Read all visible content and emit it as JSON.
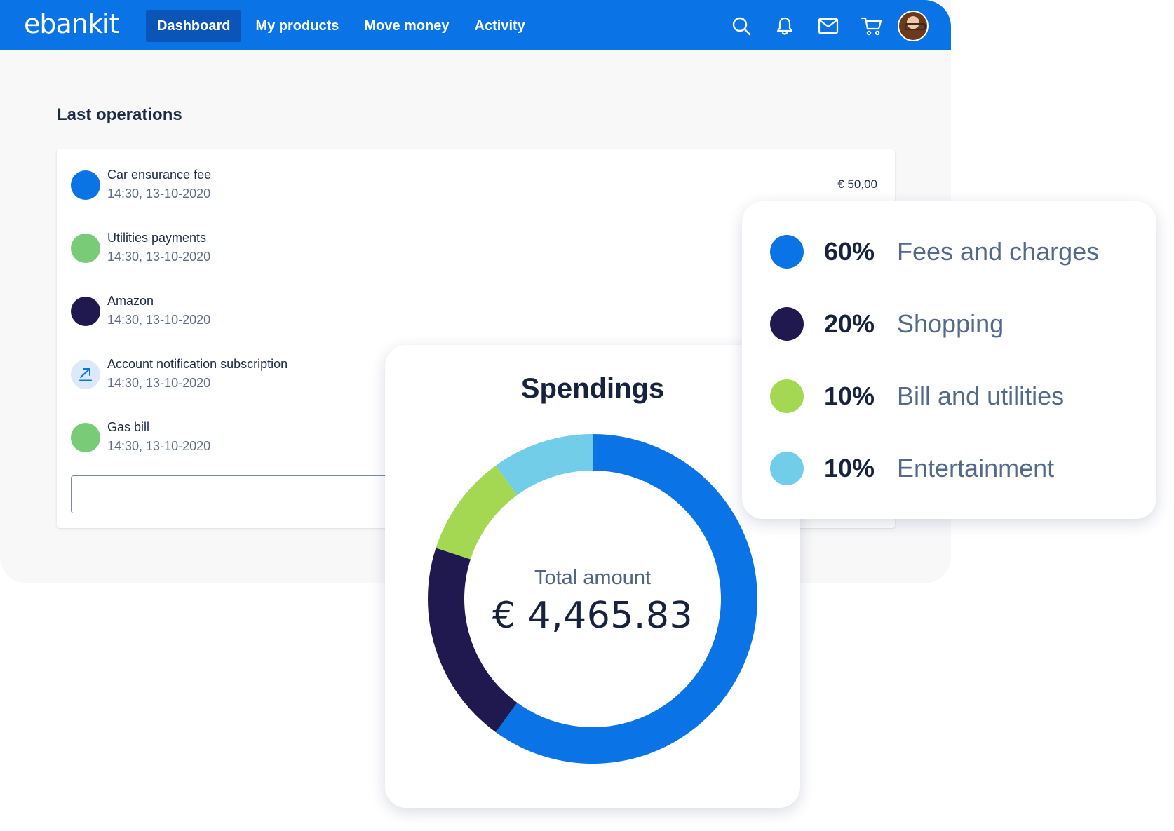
{
  "brand": {
    "logo_text": "ebankit",
    "primary_color": "#0a74e6"
  },
  "nav": {
    "tabs": [
      {
        "label": "Dashboard",
        "active": true
      },
      {
        "label": "My products",
        "active": false
      },
      {
        "label": "Move money",
        "active": false
      },
      {
        "label": "Activity",
        "active": false
      }
    ],
    "icons": [
      "search-icon",
      "bell-icon",
      "mail-icon",
      "cart-icon",
      "avatar"
    ]
  },
  "operations": {
    "title": "Last operations",
    "items": [
      {
        "title": "Car ensurance fee",
        "time": "14:30, 13-10-2020",
        "amount": "€ 50,00",
        "color": "#0a74e6",
        "icon": "dot"
      },
      {
        "title": "Utilities payments",
        "time": "14:30, 13-10-2020",
        "amount": "",
        "color": "#7acb78",
        "icon": "dot"
      },
      {
        "title": "Amazon",
        "time": "14:30, 13-10-2020",
        "amount": "",
        "color": "#20194f",
        "icon": "dot"
      },
      {
        "title": "Account notification subscription",
        "time": "14:30, 13-10-2020",
        "amount": "",
        "color": "#dbe9fb",
        "icon": "arrow-up-right-icon"
      },
      {
        "title": "Gas bill",
        "time": "14:30, 13-10-2020",
        "amount": "",
        "color": "#7acb78",
        "icon": "dot"
      }
    ]
  },
  "spendings": {
    "title": "Spendings",
    "total_label": "Total amount",
    "total_value": "€ 4,465.83"
  },
  "chart_data": {
    "type": "pie",
    "title": "Spendings",
    "categories": [
      "Fees and charges",
      "Shopping",
      "Bill and utilities",
      "Entertainment"
    ],
    "values": [
      60,
      20,
      10,
      10
    ],
    "labels": [
      "60%",
      "20%",
      "10%",
      "10%"
    ],
    "colors": [
      "#0a74e6",
      "#20194f",
      "#a4d853",
      "#72cde8"
    ]
  }
}
